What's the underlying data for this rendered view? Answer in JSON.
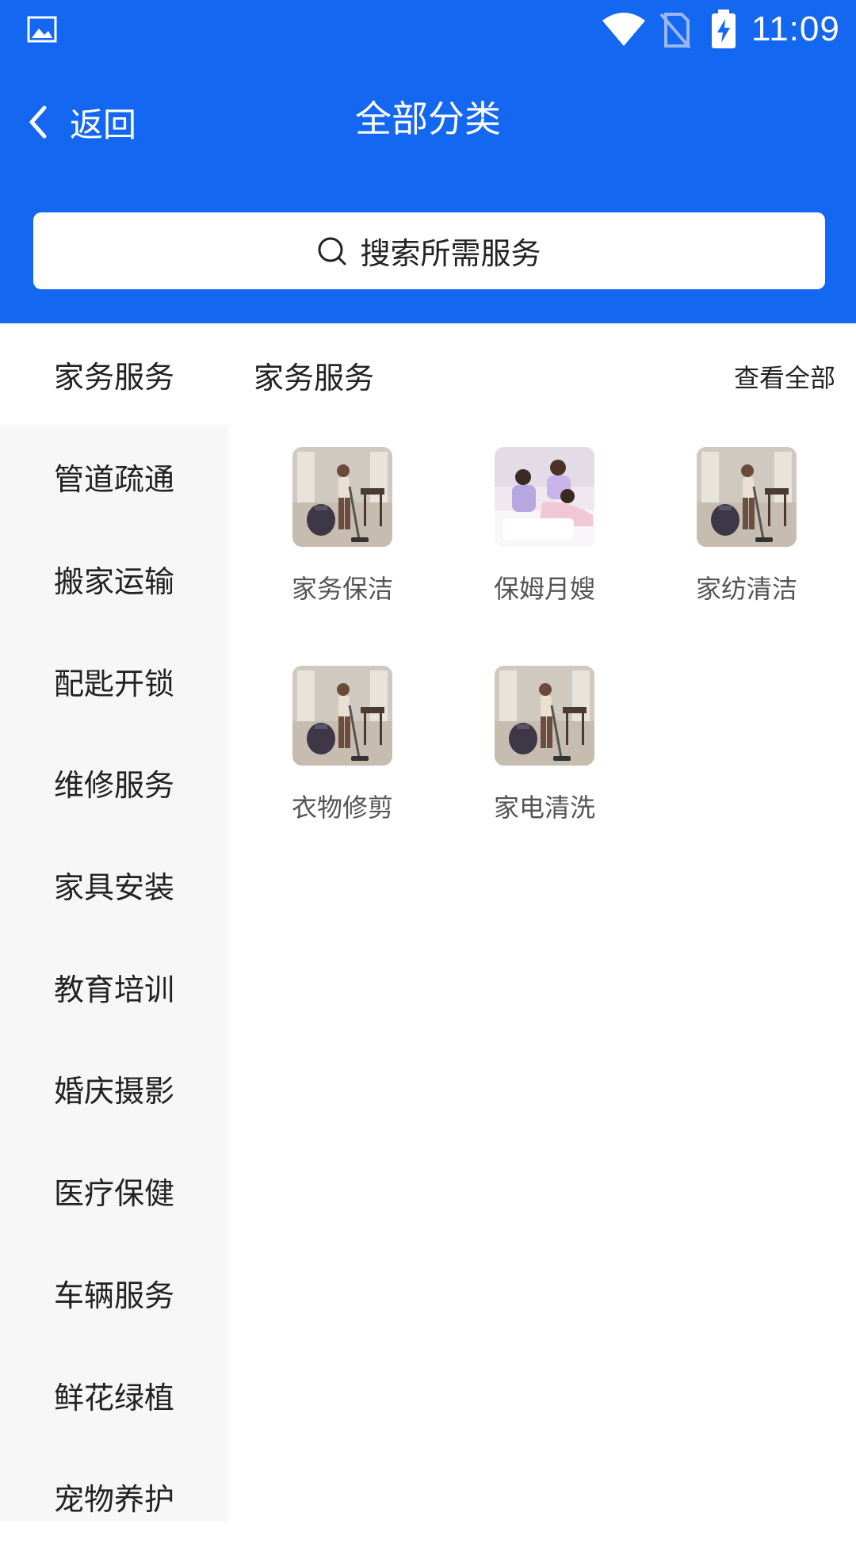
{
  "status_bar": {
    "time": "11:09",
    "icons": [
      "gallery-icon",
      "wifi-icon",
      "no-sim-icon",
      "battery-charging-icon"
    ]
  },
  "nav": {
    "back_label": "返回",
    "title": "全部分类"
  },
  "search": {
    "placeholder": "搜索所需服务"
  },
  "sidebar": {
    "items": [
      {
        "label": "家务服务",
        "active": true
      },
      {
        "label": "管道疏通"
      },
      {
        "label": "搬家运输"
      },
      {
        "label": "配匙开锁"
      },
      {
        "label": "维修服务"
      },
      {
        "label": "家具安装"
      },
      {
        "label": "教育培训"
      },
      {
        "label": "婚庆摄影"
      },
      {
        "label": "医疗保健"
      },
      {
        "label": "车辆服务"
      },
      {
        "label": "鲜花绿植"
      },
      {
        "label": "宠物养护"
      }
    ]
  },
  "content": {
    "section_title": "家务服务",
    "view_all": "查看全部",
    "items": [
      {
        "label": "家务保洁",
        "image": "vacuum-cleaning-photo"
      },
      {
        "label": "保姆月嫂",
        "image": "nanny-care-photo"
      },
      {
        "label": "家纺清洁",
        "image": "vacuum-cleaning-photo"
      },
      {
        "label": "衣物修剪",
        "image": "vacuum-cleaning-photo"
      },
      {
        "label": "家电清洗",
        "image": "vacuum-cleaning-photo"
      }
    ]
  },
  "colors": {
    "header_blue": "#1467f0",
    "sidebar_bg": "#f7f7f7",
    "active_bg": "#ffffff"
  }
}
